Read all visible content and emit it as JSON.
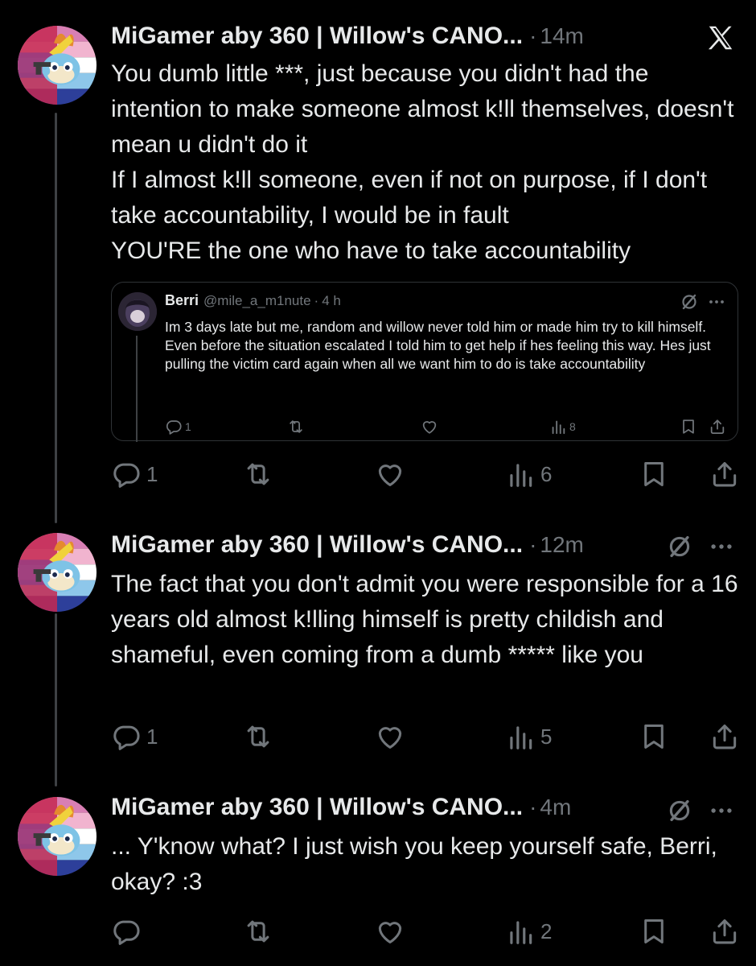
{
  "posts": [
    {
      "name": "MiGamer aby 360 | Willow's CANO...",
      "sep": "·",
      "time": "14m",
      "text": "You dumb little ***, just because you didn't had the intention to make someone almost k!ll themselves, doesn't mean u didn't do it\nIf I almost k!ll someone, even if not on purpose, if I don't take accountability, I would be in fault\nYOU'RE the one who have to take accountability",
      "replies": "1",
      "views": "6"
    },
    {
      "name": "MiGamer aby 360 | Willow's CANO...",
      "sep": "·",
      "time": "12m",
      "text": "The fact that you don't admit you were responsible for a 16 years old almost k!lling himself is pretty childish and shameful, even coming from a dumb ***** like you",
      "replies": "1",
      "views": "5"
    },
    {
      "name": "MiGamer aby 360 | Willow's CANO...",
      "sep": "·",
      "time": "4m",
      "text": "... Y'know what? I just wish you keep yourself safe, Berri, okay? :3",
      "replies": "",
      "views": "2"
    }
  ],
  "quote": {
    "name": "Berri",
    "handle": "@mile_a_m1nute",
    "sep": "·",
    "time": "4 h",
    "text": "Im 3 days late but me, random and willow never told him or made him try to kill himself. Even before the situation escalated I told him to get help if hes feeling this way. Hes just pulling the victim card again when all we want him to do is take accountability",
    "replies": "1",
    "views": "8"
  },
  "icons": {
    "brand": "x-logo-icon",
    "grok": "grok-icon",
    "more": "more-icon",
    "reply": "reply-icon",
    "repost": "repost-icon",
    "like": "like-icon",
    "views": "views-icon",
    "bookmark": "bookmark-icon",
    "share": "share-icon"
  },
  "colors": {
    "background": "#000000",
    "text": "#e7e9ea",
    "muted": "#71767b",
    "border": "#2f3336"
  }
}
